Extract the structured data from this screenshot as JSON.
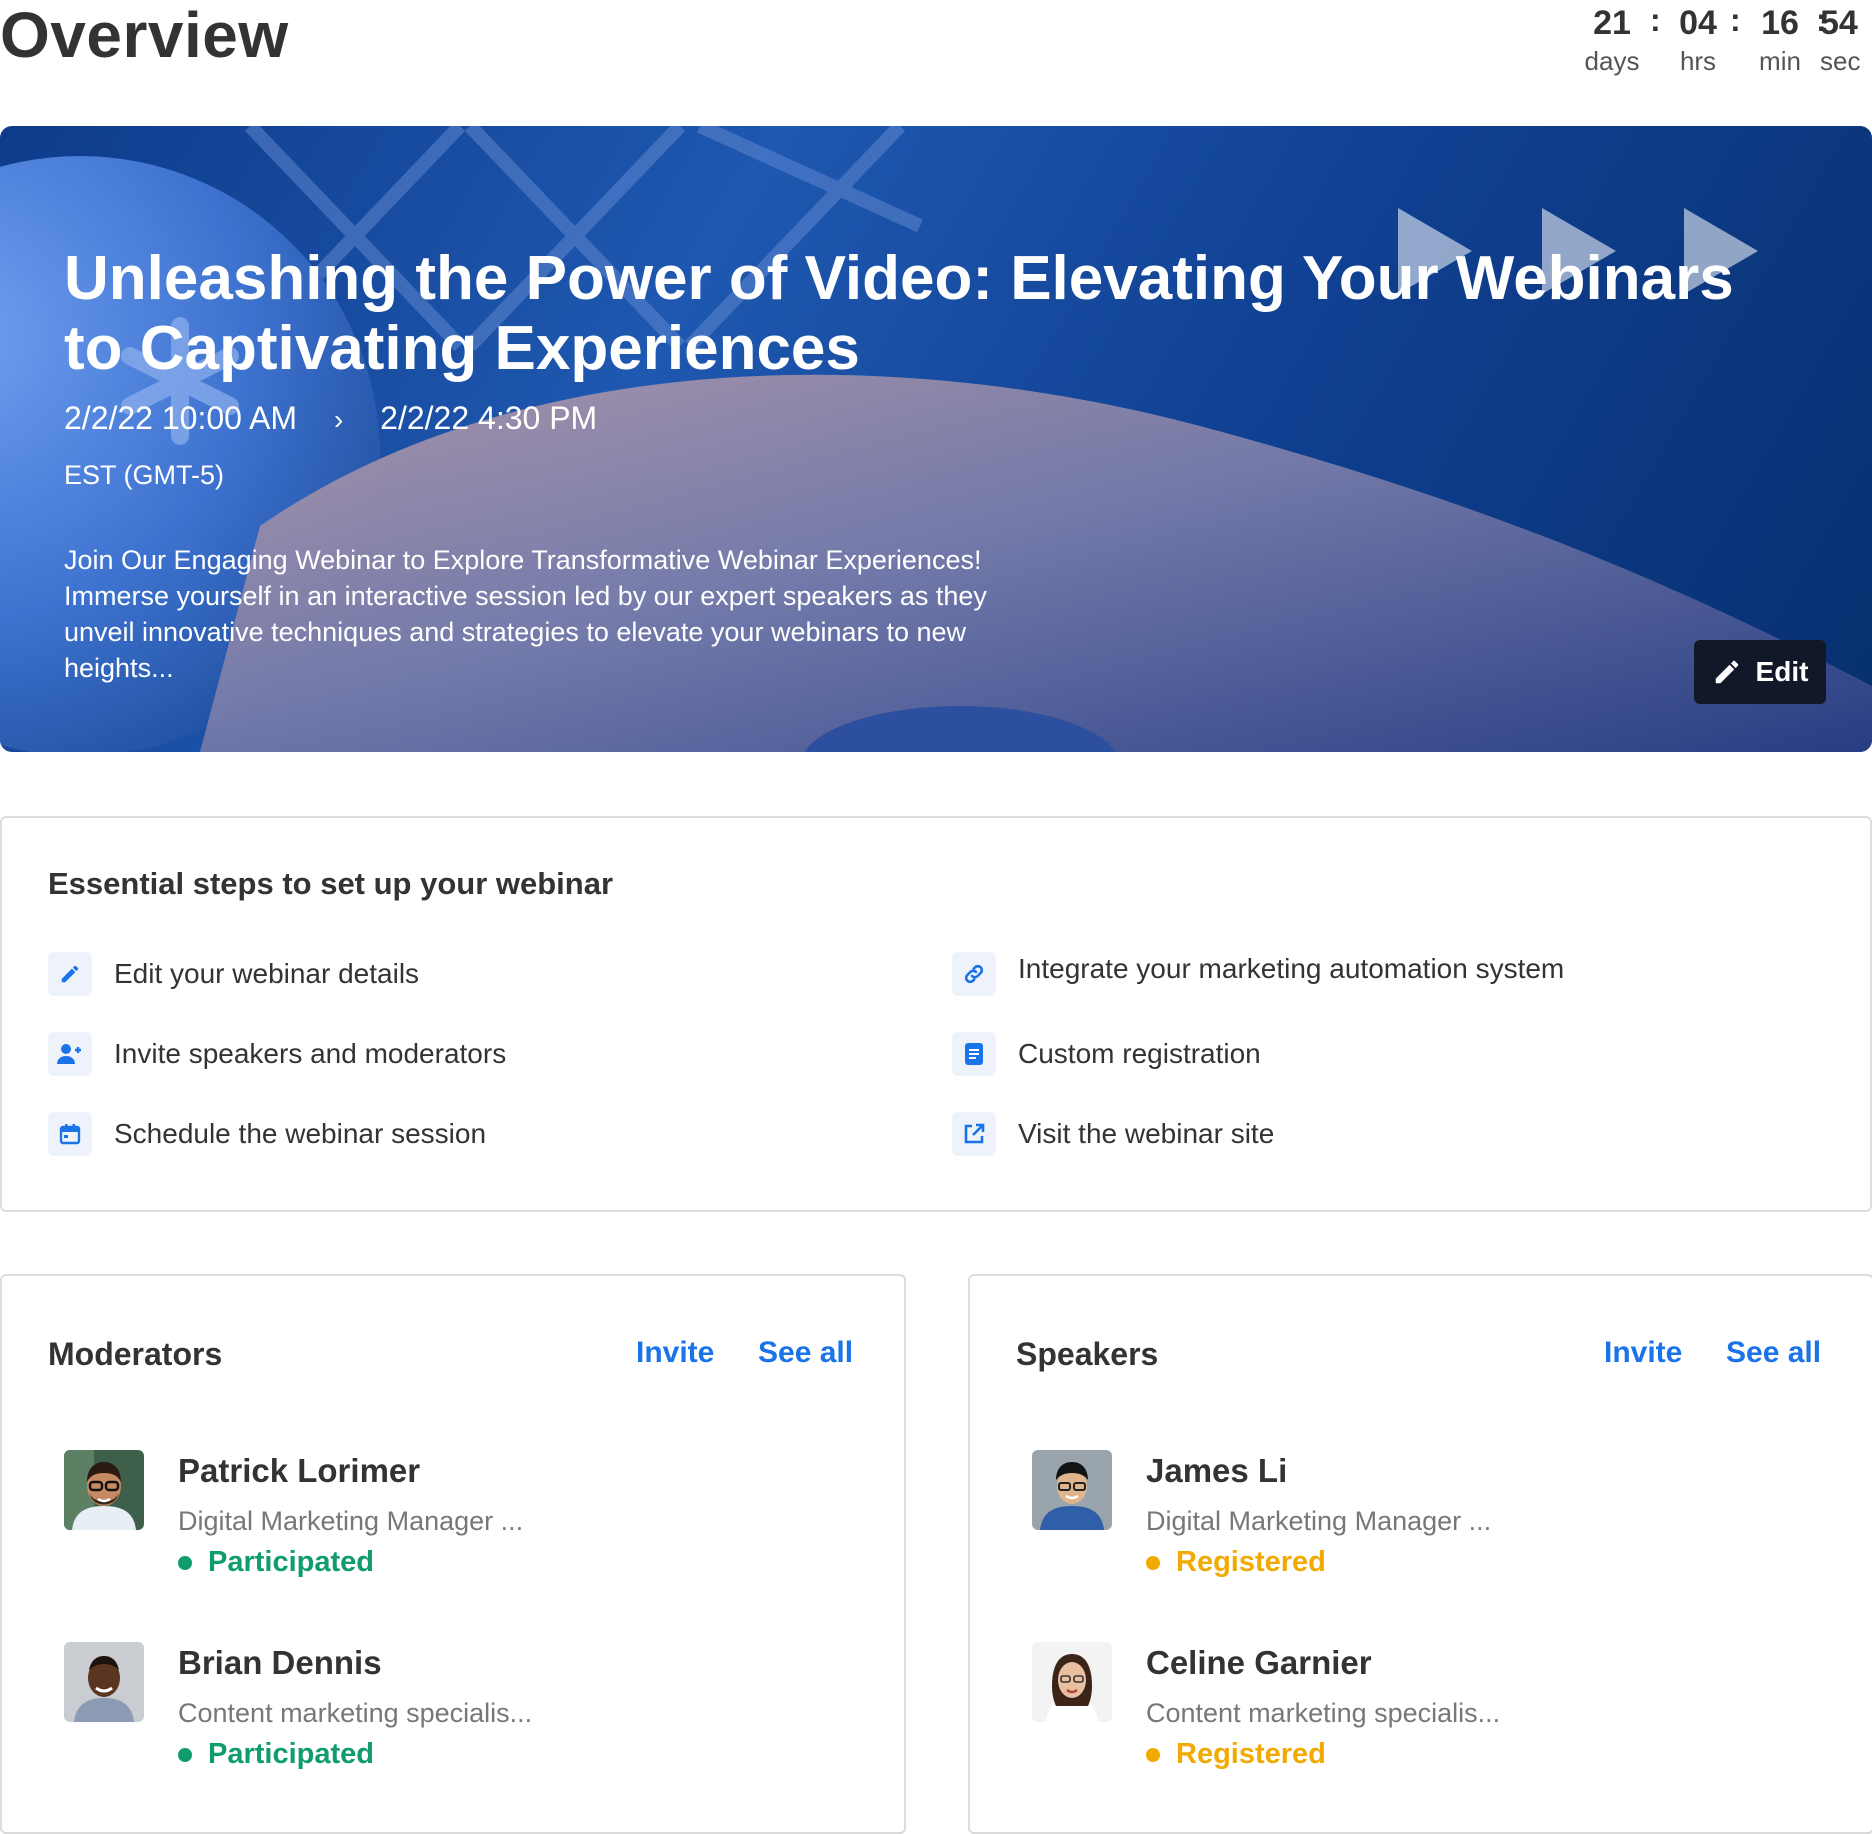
{
  "page": {
    "title": "Overview"
  },
  "countdown": {
    "days": "21",
    "days_label": "days",
    "hrs": "04",
    "hrs_label": "hrs",
    "min": "16",
    "min_label": "min",
    "sec": "54",
    "sec_label": "sec",
    "separator": ":"
  },
  "hero": {
    "title": "Unleashing the Power of Video: Elevating Your Webinars to Captivating Experiences",
    "start": "2/2/22 10:00 AM",
    "end": "2/2/22 4:30 PM",
    "timezone": "EST (GMT-5)",
    "description": "Join Our Engaging Webinar to Explore Transformative Webinar Experiences! Immerse yourself in an interactive session led by our expert speakers as they unveil innovative techniques and strategies to elevate your webinars to new heights...",
    "edit_label": "Edit"
  },
  "steps": {
    "title": "Essential steps to set up your webinar",
    "items": [
      {
        "label": "Edit your webinar details",
        "icon": "pencil-icon"
      },
      {
        "label": "Invite speakers and moderators",
        "icon": "add-user-icon"
      },
      {
        "label": "Schedule the webinar session",
        "icon": "calendar-icon"
      },
      {
        "label": "Integrate your marketing automation system",
        "icon": "link-icon"
      },
      {
        "label": "Custom registration",
        "icon": "document-icon"
      },
      {
        "label": "Visit the webinar site",
        "icon": "external-link-icon"
      }
    ]
  },
  "moderators": {
    "title": "Moderators",
    "invite_label": "Invite",
    "see_all_label": "See all",
    "people": [
      {
        "name": "Patrick Lorimer",
        "role": "Digital Marketing Manager ...",
        "status": "Participated"
      },
      {
        "name": "Brian Dennis",
        "role": "Content marketing specialis...",
        "status": "Participated"
      }
    ]
  },
  "speakers": {
    "title": "Speakers",
    "invite_label": "Invite",
    "see_all_label": "See all",
    "people": [
      {
        "name": "James Li",
        "role": "Digital Marketing Manager ...",
        "status": "Registered"
      },
      {
        "name": "Celine Garnier",
        "role": "Content marketing specialis...",
        "status": "Registered"
      }
    ]
  },
  "colors": {
    "accent": "#1a73e8",
    "participated": "#0f9d6b",
    "registered": "#f2a900",
    "hero_dark": "#0d3b8a",
    "edit_button": "#111827"
  }
}
